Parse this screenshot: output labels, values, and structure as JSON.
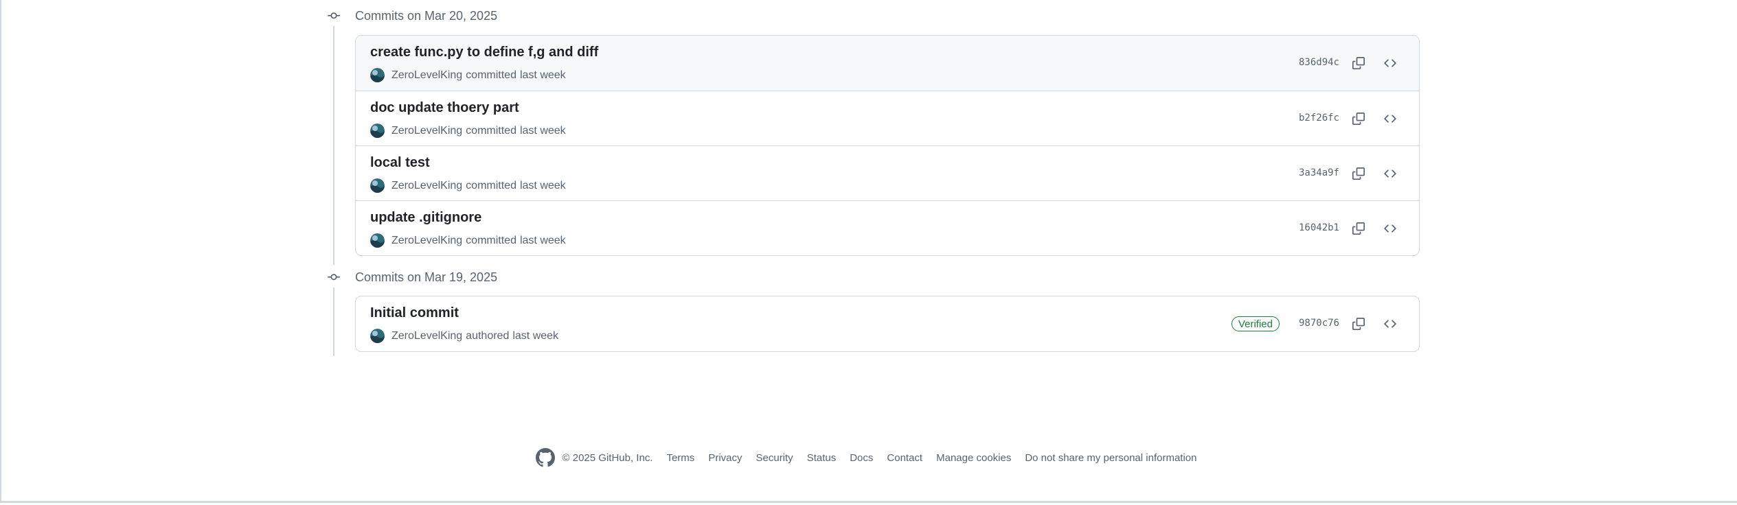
{
  "groups": [
    {
      "header": "Commits on Mar 20, 2025",
      "commits": [
        {
          "title": "create func.py to define f,g and diff",
          "author": "ZeroLevelKing",
          "action": "committed",
          "time": "last week",
          "sha": "836d94c"
        },
        {
          "title": "doc update thoery part",
          "author": "ZeroLevelKing",
          "action": "committed",
          "time": "last week",
          "sha": "b2f26fc"
        },
        {
          "title": "local test",
          "author": "ZeroLevelKing",
          "action": "committed",
          "time": "last week",
          "sha": "3a34a9f"
        },
        {
          "title": "update .gitignore",
          "author": "ZeroLevelKing",
          "action": "committed",
          "time": "last week",
          "sha": "16042b1"
        }
      ]
    },
    {
      "header": "Commits on Mar 19, 2025",
      "commits": [
        {
          "title": "Initial commit",
          "author": "ZeroLevelKing",
          "action": "authored",
          "time": "last week",
          "sha": "9870c76",
          "badge": "Verified"
        }
      ]
    }
  ],
  "footer": {
    "copyright": "© 2025 GitHub, Inc.",
    "links": [
      "Terms",
      "Privacy",
      "Security",
      "Status",
      "Docs",
      "Contact",
      "Manage cookies",
      "Do not share my personal information"
    ]
  },
  "colors": {
    "verified": "#1a7f37",
    "border": "#d0d7de",
    "muted": "#59636e"
  },
  "icons": [
    "commit-icon",
    "copy-icon",
    "code-icon",
    "github-logo-icon"
  ]
}
